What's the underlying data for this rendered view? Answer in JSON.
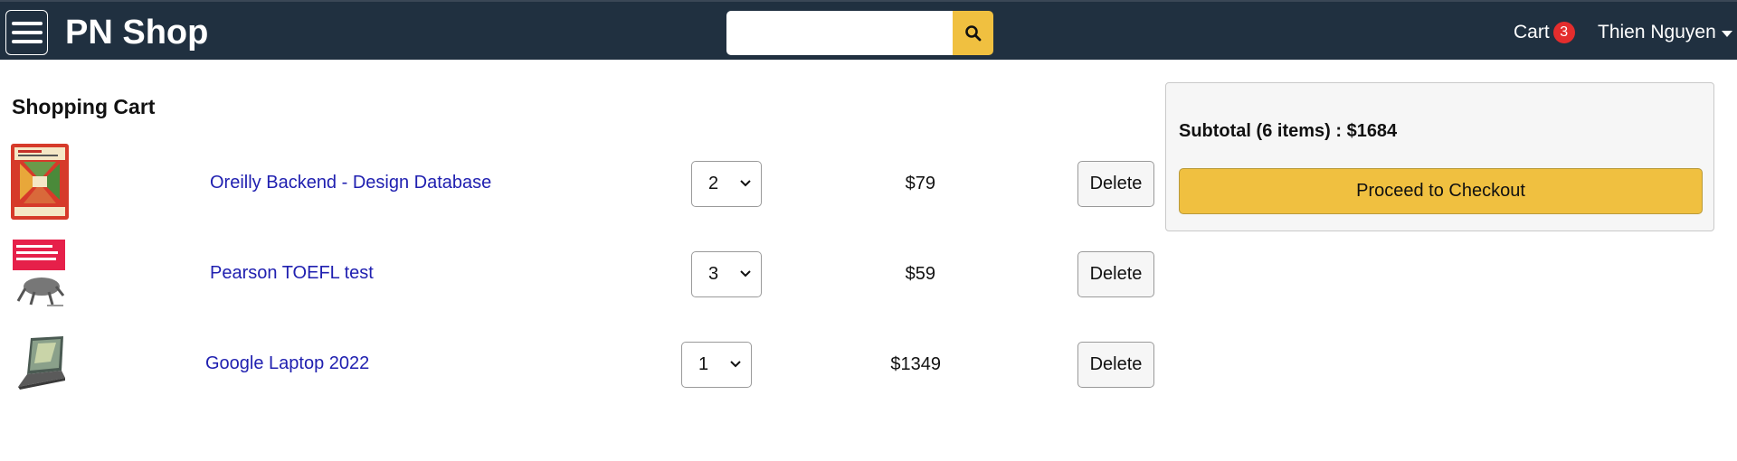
{
  "header": {
    "brand": "PN Shop",
    "search": {
      "value": "",
      "placeholder": ""
    },
    "cart_label": "Cart",
    "cart_count": "3",
    "user_name": "Thien Nguyen",
    "bg_color": "#203040",
    "accent_color": "#f0c040"
  },
  "main": {
    "title": "Shopping Cart",
    "items": [
      {
        "name": "Oreilly Backend - Design Database",
        "qty": "2",
        "price": "$79",
        "delete_label": "Delete"
      },
      {
        "name": "Pearson TOEFL test",
        "qty": "3",
        "price": "$59",
        "delete_label": "Delete"
      },
      {
        "name": "Google Laptop 2022",
        "qty": "1",
        "price": "$1349",
        "delete_label": "Delete"
      }
    ]
  },
  "summary": {
    "subtotal": "Subtotal (6 items) : $1684",
    "checkout_label": "Proceed to Checkout"
  }
}
